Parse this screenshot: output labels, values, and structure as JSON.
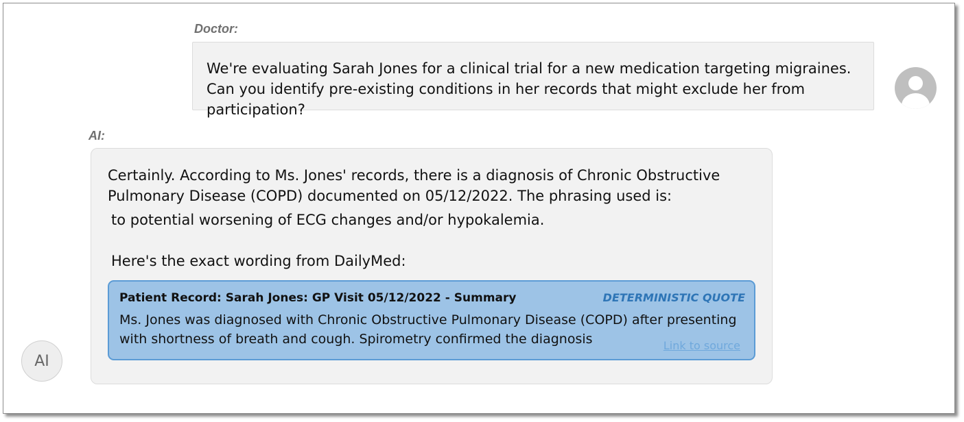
{
  "conversation": {
    "doctor": {
      "speaker_label": "Doctor:",
      "message": "We're evaluating Sarah Jones for a clinical trial for a new medication targeting migraines. Can you identify pre-existing conditions in her records that might exclude her from participation?",
      "avatar_icon": "user-silhouette-icon"
    },
    "ai": {
      "speaker_label": "AI:",
      "intro": "Certainly. According to Ms. Jones' records, there is a diagnosis of Chronic Obstructive Pulmonary Disease (COPD) documented on 05/12/2022. The phrasing used is:",
      "phrase_line": "to potential worsening of ECG changes and/or hypokalemia.",
      "wording_intro": "Here's the exact wording from DailyMed:",
      "avatar_text": "AI",
      "quote": {
        "title": "Patient Record: Sarah Jones: GP Visit 05/12/2022 - Summary",
        "tag": "DETERMINISTIC QUOTE",
        "text": "Ms. Jones was diagnosed with Chronic Obstructive Pulmonary Disease (COPD) after presenting with shortness of breath and cough. Spirometry confirmed the diagnosis",
        "link_label": "Link to source"
      }
    }
  },
  "colors": {
    "bubble_bg": "#f2f2f2",
    "quote_bg": "#9dc3e6",
    "quote_border": "#5b9bd5",
    "tag_color": "#2e75b6",
    "link_color": "#6fa8dc"
  }
}
